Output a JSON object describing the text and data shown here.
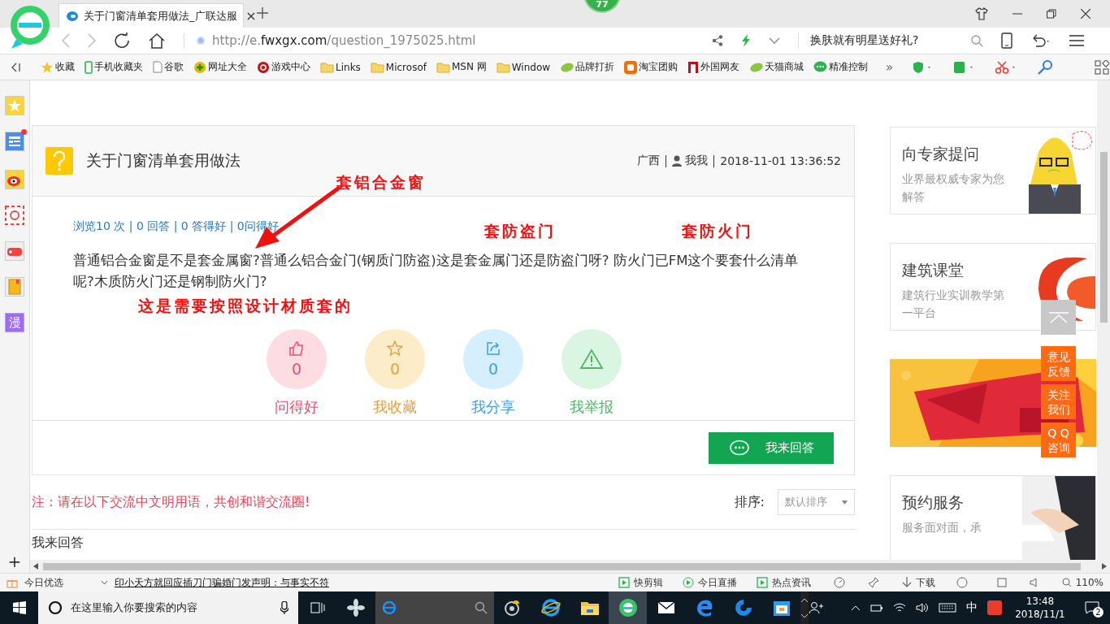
{
  "browser": {
    "tab": {
      "title": "关于门窗清单套用做法_广联达服",
      "selected": true
    },
    "badge": "77",
    "url": {
      "scheme": "http://e.",
      "domain": "fwxgx.com",
      "path": "/question_1975025.html"
    },
    "search": {
      "placeholder": "换肤就有明星送好礼?"
    },
    "favorites": [
      {
        "label": "收藏",
        "kind": "star"
      },
      {
        "label": "手机收藏夹",
        "kind": "phone"
      },
      {
        "label": "谷歌",
        "kind": "page"
      },
      {
        "label": "网址大全",
        "kind": "globe"
      },
      {
        "label": "游戏中心",
        "kind": "game"
      },
      {
        "label": "Links",
        "kind": "folder"
      },
      {
        "label": "Microsof",
        "kind": "folder"
      },
      {
        "label": "MSN 网",
        "kind": "folder"
      },
      {
        "label": "Window",
        "kind": "folder"
      },
      {
        "label": "品牌打折",
        "kind": "leaf"
      },
      {
        "label": "淘宝团购",
        "kind": "tao"
      },
      {
        "label": "外国网友",
        "kind": "red"
      },
      {
        "label": "天猫商城",
        "kind": "leaf"
      },
      {
        "label": "精准控制",
        "kind": "chat"
      }
    ],
    "more": "»"
  },
  "sidebar": {
    "items": [
      {
        "kind": "star"
      },
      {
        "kind": "news",
        "unread": true
      },
      {
        "kind": "weibo"
      },
      {
        "kind": "mail"
      },
      {
        "kind": "game"
      },
      {
        "kind": "book"
      },
      {
        "kind": "comic",
        "label": "漫"
      }
    ],
    "add": "+"
  },
  "question": {
    "title": "关于门窗清单套用做法",
    "location": "广西",
    "user": "我我",
    "time": "2018-11-01 13:36:52",
    "stats": "浏览10 次 | 0 回答 | 0 答得好 | 0问得好",
    "body": "普通铝合金窗是不是套金属窗?普通么铝合金门(钢质门防盗)这是套金属门还是防盗门呀?  防火门已FM这个要套什么清单呢?木质防火门还是钢制防火门?",
    "actions": [
      {
        "kind": "like",
        "count": "0",
        "label": "问得好"
      },
      {
        "kind": "fav",
        "count": "0",
        "label": "我收藏"
      },
      {
        "kind": "share",
        "count": "0",
        "label": "我分享"
      },
      {
        "kind": "report",
        "label": "我举报"
      }
    ],
    "answer_button": "我来回答"
  },
  "annotations": [
    "套铝合金窗",
    "套防盗门",
    "套防火门",
    "这是需要按照设计材质套的"
  ],
  "notice": "注：请在以下交流中文明用语，共创和谐交流圈!",
  "sort": {
    "label": "排序:",
    "value": "默认排序"
  },
  "answers_heading": "我来回答",
  "ads": [
    {
      "kind": "expert",
      "title": "向专家提问",
      "text": "业界最权威专家为您解答"
    },
    {
      "kind": "school",
      "title": "建筑课堂",
      "text": "建筑行业实训教学第一平台"
    },
    {
      "kind": "picture"
    },
    {
      "kind": "service",
      "title": "预约服务",
      "text": "服务面对面，承"
    }
  ],
  "float_buttons": [
    "意见反馈",
    "关注我们",
    "Q Q 咨询"
  ],
  "status_bar": {
    "left": "今日优选",
    "news": "印小天方就回应插刀门骗婚门发声明：与事实不符",
    "items": [
      "快剪辑",
      "今日直播",
      "热点资讯"
    ],
    "download": "下载",
    "zoom": "110%"
  },
  "taskbar": {
    "search": "在这里输入你要搜索的内容",
    "ime": "中",
    "time": "13:48",
    "date": "2018/11/1",
    "notifications": "2"
  }
}
